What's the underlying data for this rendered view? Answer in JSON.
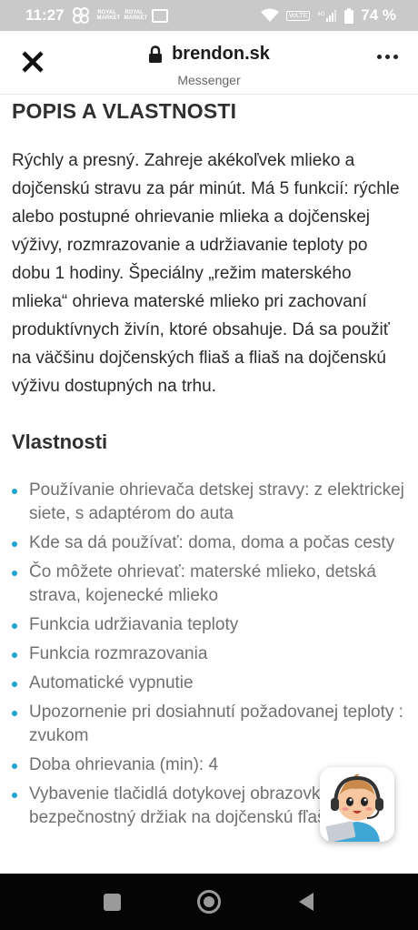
{
  "status_bar": {
    "time": "11:27",
    "logo_text": "ROYAL MARKET",
    "volte": "VoLTE",
    "network": "4G",
    "battery": "74 %"
  },
  "browser": {
    "url": "brendon.sk",
    "source": "Messenger"
  },
  "content": {
    "section_title": "POPIS A VLASTNOSTI",
    "description": "Rýchly a presný. Zahreje akékoľvek mlieko a dojčenskú stravu za pár minút. Má 5 funkcií: rýchle alebo postupné ohrievanie mlieka a dojčenskej výživy, rozmrazovanie a udržiavanie teploty po dobu 1 hodiny. Špeciálny „režim materského mlieka“ ohrieva materské mlieko pri zachovaní produktívnych živín, ktoré obsahuje. Dá sa použiť na väčšinu dojčenských fliaš a fliaš na dojčenskú výživu dostupných na trhu.",
    "subsection_title": "Vlastnosti",
    "features": [
      "Používanie ohrievača detskej stravy: z elektrickej siete, s adaptérom do auta",
      "Kde sa dá používať: doma, doma a počas cesty",
      "Čo môžete ohrievať: materské mlieko, detská strava, kojenecké mlieko",
      "Funkcia udržiavania teploty",
      "Funkcia rozmrazovania",
      "Automatické vypnutie",
      "Upozornenie pri dosiahnutí požadovanej teploty : zvukom",
      "Doba ohrievania (min): 4",
      "Vybavenie tlačidlá dotykovej obrazovky, bezpečnostný držiak na dojčenskú fľašu"
    ]
  },
  "colors": {
    "status_bar_bg": "#c9c9c9",
    "bullet": "#1fa3cf",
    "nav_bar_bg": "#050505"
  },
  "icons": {
    "close": "close-icon",
    "lock": "lock-icon",
    "menu": "more-vertical-icon",
    "chat": "support-avatar-icon",
    "nav_recent": "recent-apps-icon",
    "nav_home": "home-icon",
    "nav_back": "back-icon"
  }
}
